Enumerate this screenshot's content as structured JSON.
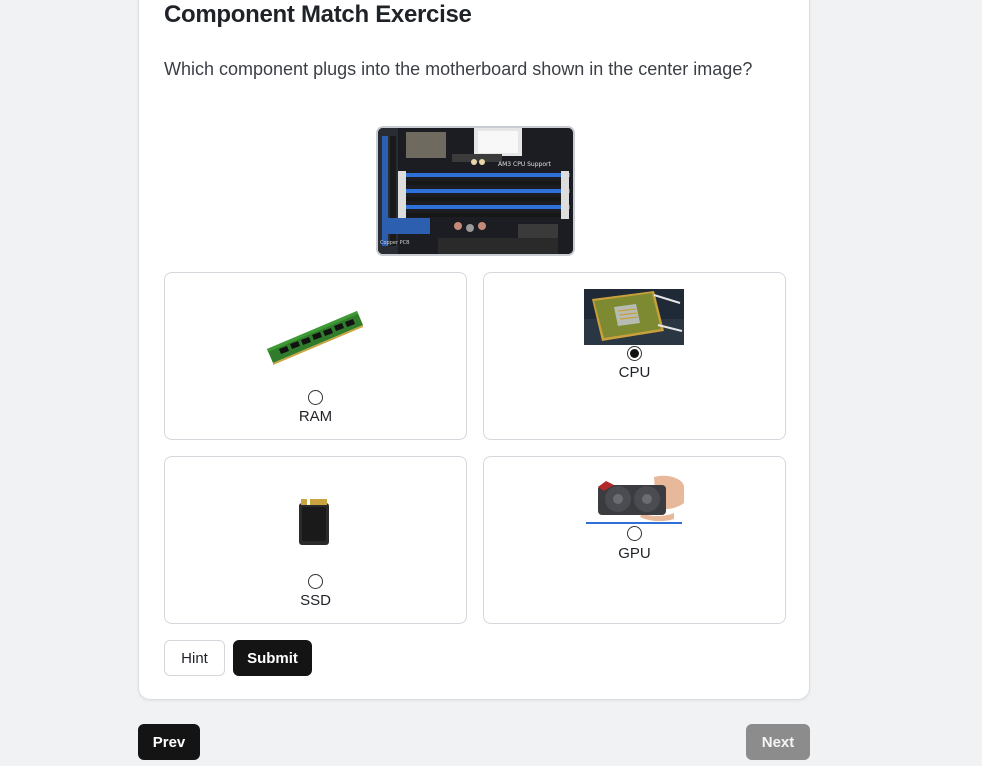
{
  "exercise": {
    "title": "Component Match Exercise",
    "question": "Which component plugs into the motherboard shown in the center image?",
    "center_image_icon": "motherboard-image"
  },
  "options": [
    {
      "label": "RAM",
      "icon": "ram-module-image",
      "selected": false
    },
    {
      "label": "CPU",
      "icon": "cpu-chip-image",
      "selected": true
    },
    {
      "label": "SSD",
      "icon": "ssd-card-image",
      "selected": false
    },
    {
      "label": "GPU",
      "icon": "graphics-card-image",
      "selected": false
    }
  ],
  "actions": {
    "hint_label": "Hint",
    "submit_label": "Submit"
  },
  "navigation": {
    "prev_label": "Prev",
    "next_label": "Next"
  },
  "colors": {
    "primary": "#141414",
    "disabled": "#8c8c8c",
    "background": "#f1f2f4"
  }
}
